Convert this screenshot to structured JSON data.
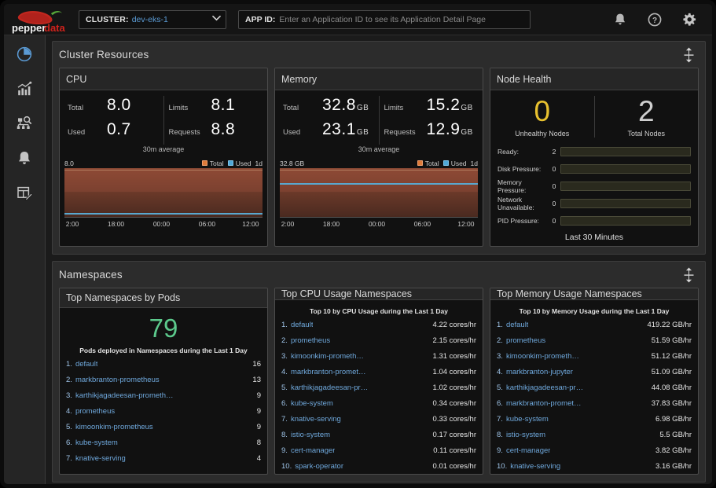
{
  "topbar": {
    "logo_text_1": "pepper",
    "logo_text_2": "data",
    "cluster_label": "CLUSTER:",
    "cluster_value": "dev-eks-1",
    "caret": "⌄",
    "appid_label": "APP ID:",
    "appid_placeholder": "Enter an Application ID to see its Application Detail Page",
    "appid_value": "",
    "icons": [
      "bell-icon",
      "help-icon",
      "gear-icon"
    ]
  },
  "sidebar": {
    "items": [
      {
        "name": "dashboard-icon",
        "active": true
      },
      {
        "name": "charts-icon",
        "active": false
      },
      {
        "name": "cluster-explore-icon",
        "active": false
      },
      {
        "name": "alerts-bell-icon",
        "active": false
      },
      {
        "name": "reports-icon",
        "active": false
      }
    ]
  },
  "sections": [
    {
      "title": "Cluster Resources"
    },
    {
      "title": "Namespaces"
    }
  ],
  "cpu": {
    "title": "CPU",
    "stats": [
      {
        "key": "Total",
        "value": "8.0",
        "unit": ""
      },
      {
        "key": "Used",
        "value": "0.7",
        "unit": ""
      },
      {
        "key": "Limits",
        "value": "8.1",
        "unit": ""
      },
      {
        "key": "Requests",
        "value": "8.8",
        "unit": ""
      }
    ],
    "avg_note": "30m average"
  },
  "memory": {
    "title": "Memory",
    "stats": [
      {
        "key": "Total",
        "value": "32.8",
        "unit": "GB"
      },
      {
        "key": "Used",
        "value": "23.1",
        "unit": "GB"
      },
      {
        "key": "Limits",
        "value": "15.2",
        "unit": "GB"
      },
      {
        "key": "Requests",
        "value": "12.9",
        "unit": "GB"
      }
    ],
    "avg_note": "30m average"
  },
  "node_health": {
    "title": "Node Health",
    "unhealthy_value": "0",
    "unhealthy_label": "Unhealthy Nodes",
    "total_value": "2",
    "total_label": "Total Nodes",
    "bars": [
      {
        "label": "Ready:",
        "count": "2",
        "pct": 100
      },
      {
        "label": "Disk Pressure:",
        "count": "0",
        "pct": 0
      },
      {
        "label": "Memory Pressure:",
        "count": "0",
        "pct": 0
      },
      {
        "label": "Network Unavailable:",
        "count": "0",
        "pct": 0
      },
      {
        "label": "PID Pressure:",
        "count": "0",
        "pct": 0
      }
    ],
    "footer": "Last 30 Minutes"
  },
  "pods_card": {
    "title": "Top Namespaces by Pods",
    "big_value": "79",
    "subtitle": "Pods deployed in Namespaces during the Last 1 Day",
    "rows": [
      {
        "rank": "1.",
        "name": "default",
        "value": "16"
      },
      {
        "rank": "2.",
        "name": "markbranton-prometheus",
        "value": "13"
      },
      {
        "rank": "3.",
        "name": "karthikjagadeesan-prometh…",
        "value": "9"
      },
      {
        "rank": "4.",
        "name": "prometheus",
        "value": "9"
      },
      {
        "rank": "5.",
        "name": "kimoonkim-prometheus",
        "value": "9"
      },
      {
        "rank": "6.",
        "name": "kube-system",
        "value": "8"
      },
      {
        "rank": "7.",
        "name": "knative-serving",
        "value": "4"
      }
    ]
  },
  "cpu_card": {
    "title": "Top CPU Usage Namespaces",
    "subtitle": "Top 10 by CPU Usage during the Last 1 Day",
    "rows": [
      {
        "rank": "1.",
        "name": "default",
        "value": "4.22 cores/hr"
      },
      {
        "rank": "2.",
        "name": "prometheus",
        "value": "2.15 cores/hr"
      },
      {
        "rank": "3.",
        "name": "kimoonkim-prometh…",
        "value": "1.31 cores/hr"
      },
      {
        "rank": "4.",
        "name": "markbranton-promet…",
        "value": "1.04 cores/hr"
      },
      {
        "rank": "5.",
        "name": "karthikjagadeesan-pr…",
        "value": "1.02 cores/hr"
      },
      {
        "rank": "6.",
        "name": "kube-system",
        "value": "0.34 cores/hr"
      },
      {
        "rank": "7.",
        "name": "knative-serving",
        "value": "0.33 cores/hr"
      },
      {
        "rank": "8.",
        "name": "istio-system",
        "value": "0.17 cores/hr"
      },
      {
        "rank": "9.",
        "name": "cert-manager",
        "value": "0.11 cores/hr"
      },
      {
        "rank": "10.",
        "name": "spark-operator",
        "value": "0.01 cores/hr"
      }
    ]
  },
  "mem_card": {
    "title": "Top Memory Usage Namespaces",
    "subtitle": "Top 10 by Memory Usage during the Last 1 Day",
    "rows": [
      {
        "rank": "1.",
        "name": "default",
        "value": "419.22 GB/hr"
      },
      {
        "rank": "2.",
        "name": "prometheus",
        "value": "51.59 GB/hr"
      },
      {
        "rank": "3.",
        "name": "kimoonkim-prometh…",
        "value": "51.12 GB/hr"
      },
      {
        "rank": "4.",
        "name": "markbranton-jupyter",
        "value": "51.09 GB/hr"
      },
      {
        "rank": "5.",
        "name": "karthikjagadeesan-pr…",
        "value": "44.08 GB/hr"
      },
      {
        "rank": "6.",
        "name": "markbranton-promet…",
        "value": "37.83 GB/hr"
      },
      {
        "rank": "7.",
        "name": "kube-system",
        "value": "6.98 GB/hr"
      },
      {
        "rank": "8.",
        "name": "istio-system",
        "value": "5.5 GB/hr"
      },
      {
        "rank": "9.",
        "name": "cert-manager",
        "value": "3.82 GB/hr"
      },
      {
        "rank": "10.",
        "name": "knative-serving",
        "value": "3.16 GB/hr"
      }
    ]
  },
  "chart_data": [
    {
      "type": "area",
      "id": "cpu-mini-chart",
      "title": "CPU",
      "ylabel_max": "8.0",
      "series": [
        {
          "name": "Total",
          "color": "#e07b39",
          "level_frac": 0.97
        },
        {
          "name": "Used",
          "color": "#4fa8d8",
          "level_frac": 0.09
        }
      ],
      "legend": [
        "Total",
        "Used"
      ],
      "range_label": "1d",
      "xticks": [
        "2:00",
        "18:00",
        "00:00",
        "06:00",
        "12:00"
      ],
      "ylim": [
        0,
        8.0
      ],
      "grid": false
    },
    {
      "type": "area",
      "id": "memory-mini-chart",
      "title": "Memory",
      "ylabel_max": "32.8 GB",
      "series": [
        {
          "name": "Total",
          "color": "#e07b39",
          "level_frac": 0.97
        },
        {
          "name": "Used",
          "color": "#4fa8d8",
          "level_frac": 0.7
        }
      ],
      "legend": [
        "Total",
        "Used"
      ],
      "range_label": "1d",
      "xticks": [
        "2:00",
        "18:00",
        "00:00",
        "06:00",
        "12:00"
      ],
      "ylim": [
        0,
        32.8
      ],
      "grid": false
    },
    {
      "type": "bar",
      "id": "node-health-bars",
      "title": "Node Health",
      "categories": [
        "Ready",
        "Disk Pressure",
        "Memory Pressure",
        "Network Unavailable",
        "PID Pressure"
      ],
      "values": [
        2,
        0,
        0,
        0,
        0
      ],
      "ylim": [
        0,
        2
      ],
      "xlabel": "",
      "ylabel": "",
      "grid": false
    },
    {
      "type": "bar",
      "id": "top-namespaces-by-pods",
      "title": "Top Namespaces by Pods",
      "categories": [
        "default",
        "markbranton-prometheus",
        "karthikjagadeesan-prometh…",
        "prometheus",
        "kimoonkim-prometheus",
        "kube-system",
        "knative-serving"
      ],
      "values": [
        16,
        13,
        9,
        9,
        9,
        8,
        4
      ],
      "ylabel": "Pods",
      "xlabel": "",
      "grid": false
    },
    {
      "type": "bar",
      "id": "top-cpu-usage-namespaces",
      "title": "Top CPU Usage Namespaces",
      "categories": [
        "default",
        "prometheus",
        "kimoonkim-prometh…",
        "markbranton-promet…",
        "karthikjagadeesan-pr…",
        "kube-system",
        "knative-serving",
        "istio-system",
        "cert-manager",
        "spark-operator"
      ],
      "values": [
        4.22,
        2.15,
        1.31,
        1.04,
        1.02,
        0.34,
        0.33,
        0.17,
        0.11,
        0.01
      ],
      "ylabel": "cores/hr",
      "xlabel": "",
      "grid": false
    },
    {
      "type": "bar",
      "id": "top-memory-usage-namespaces",
      "title": "Top Memory Usage Namespaces",
      "categories": [
        "default",
        "prometheus",
        "kimoonkim-prometh…",
        "markbranton-jupyter",
        "karthikjagadeesan-pr…",
        "markbranton-promet…",
        "kube-system",
        "istio-system",
        "cert-manager",
        "knative-serving"
      ],
      "values": [
        419.22,
        51.59,
        51.12,
        51.09,
        44.08,
        37.83,
        6.98,
        5.5,
        3.82,
        3.16
      ],
      "ylabel": "GB/hr",
      "xlabel": "",
      "grid": false
    }
  ],
  "colors": {
    "accent_blue": "#6fa8dc",
    "green": "#5cc98c",
    "warn_yellow": "#e8c12f",
    "bar_green": "#a6b84a",
    "area_orange": "#8e4a35",
    "used_blue": "#4fa8d8"
  }
}
